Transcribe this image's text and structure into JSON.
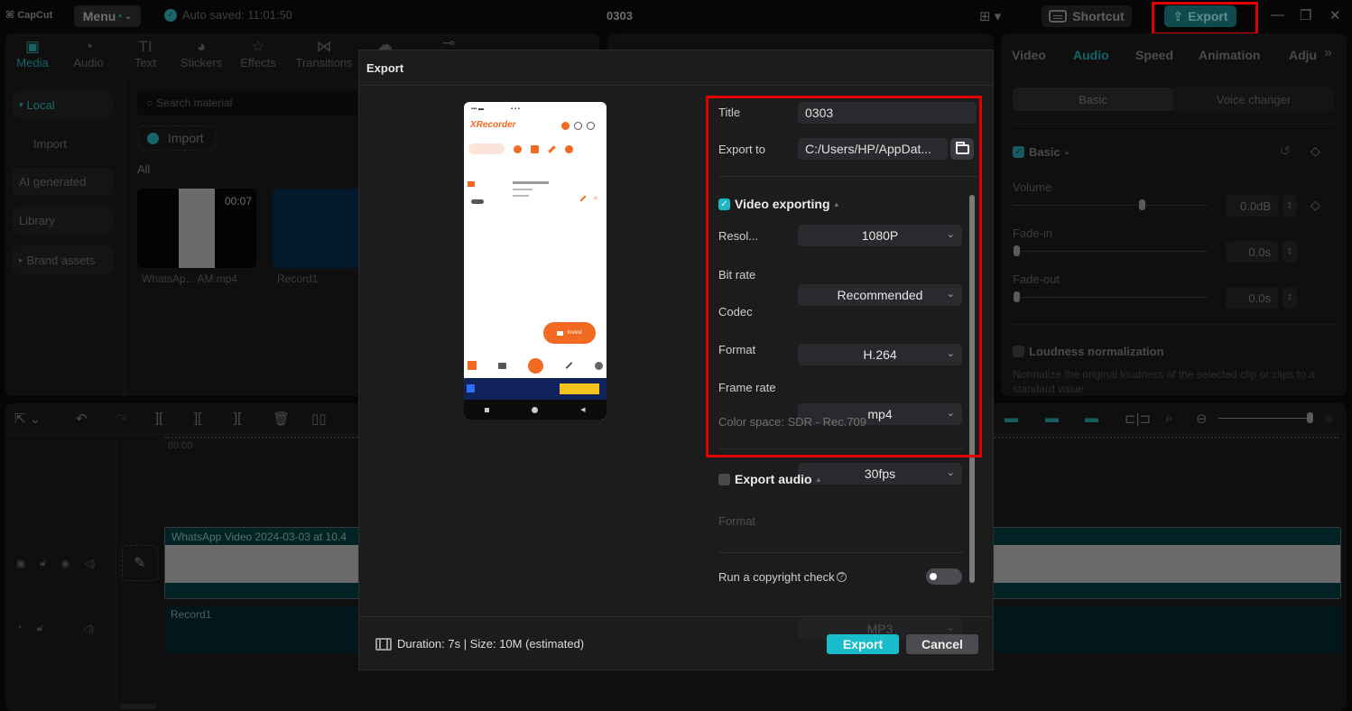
{
  "app": {
    "logo": "CapCut",
    "menu_label": "Menu",
    "autosave": "Auto saved: 11:01:50",
    "project_title": "0303",
    "shortcut_label": "Shortcut",
    "export_label": "Export"
  },
  "toolbar_tabs": [
    {
      "label": "Media",
      "icon": "media-icon",
      "glyph": "▣",
      "active": true
    },
    {
      "label": "Audio",
      "icon": "audio-icon",
      "glyph": "◔"
    },
    {
      "label": "Text",
      "icon": "text-icon",
      "glyph": "TI"
    },
    {
      "label": "Stickers",
      "icon": "sticker-icon",
      "glyph": "◕"
    },
    {
      "label": "Effects",
      "icon": "effects-icon",
      "glyph": "☆"
    },
    {
      "label": "Transitions",
      "icon": "transitions-icon",
      "glyph": "⋈"
    }
  ],
  "media": {
    "nav": [
      {
        "label": "Local",
        "prefix": "▾",
        "active": true
      },
      {
        "label": "Import"
      },
      {
        "label": "AI generated"
      },
      {
        "label": "Library"
      },
      {
        "label": "Brand assets",
        "prefix": "▸"
      }
    ],
    "search_placeholder": "Search material",
    "import_label": "Import",
    "all_label": "All",
    "items": [
      {
        "name": "WhatsAp... AM.mp4",
        "duration": "00:07"
      },
      {
        "name": "Record1"
      }
    ]
  },
  "properties": {
    "tabs": [
      "Video",
      "Audio",
      "Speed",
      "Animation",
      "Adju"
    ],
    "active_tab": "Audio",
    "more_glyph": "»",
    "segments": [
      "Basic",
      "Voice changer"
    ],
    "basic_label": "Basic",
    "volume_label": "Volume",
    "volume_value": "0.0dB",
    "volume_level": 0.66,
    "fade_in_label": "Fade-in",
    "fade_in_value": "0.0s",
    "fade_out_label": "Fade-out",
    "fade_out_value": "0.0s",
    "loudness_label": "Loudness normalization",
    "loudness_desc": "Normalize the original loudness of the selected clip or clips to a standard value"
  },
  "timeline": {
    "timecode": "00:00",
    "video_clip": "WhatsApp Video 2024-03-03 at 10.4",
    "audio_clip": "Record1"
  },
  "dialog": {
    "title": "Export",
    "title_label": "Title",
    "title_value": "0303",
    "export_to_label": "Export to",
    "export_to_value": "C:/Users/HP/AppDat...",
    "video_section": "Video exporting",
    "video_enabled": true,
    "resolution_label": "Resol...",
    "resolution_value": "1080P",
    "bitrate_label": "Bit rate",
    "bitrate_value": "Recommended",
    "codec_label": "Codec",
    "codec_value": "H.264",
    "format_label": "Format",
    "format_value": "mp4",
    "framerate_label": "Frame rate",
    "framerate_value": "30fps",
    "color_space": "Color space: SDR - Rec.709",
    "audio_section": "Export audio",
    "audio_enabled": false,
    "audio_format_label": "Format",
    "audio_format_value": "MP3",
    "copyright_label": "Run a copyright check",
    "copyright_enabled": false,
    "duration_info": "Duration: 7s | Size: 10M (estimated)",
    "export_button": "Export",
    "cancel_button": "Cancel"
  },
  "preview_phone": {
    "app_name": "XRecorder",
    "button_label": "Invest"
  },
  "colors": {
    "accent": "#19bccb",
    "highlight": "#e00000",
    "orange": "#f26a21"
  }
}
